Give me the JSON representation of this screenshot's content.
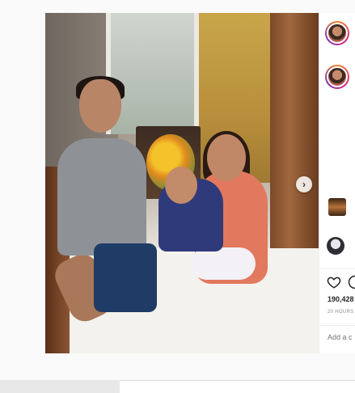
{
  "post": {
    "carousel_next_label": "›"
  },
  "panel": {
    "likes": "190,428",
    "time": "20 HOURS",
    "comment_placeholder": "Add a c"
  },
  "icons": {
    "like": "heart-icon",
    "comment": "comment-icon",
    "next": "chevron-right-icon"
  },
  "colors": {
    "story_ring": "#dd2a7b",
    "text_primary": "#262626",
    "text_secondary": "#8e8e8e"
  }
}
